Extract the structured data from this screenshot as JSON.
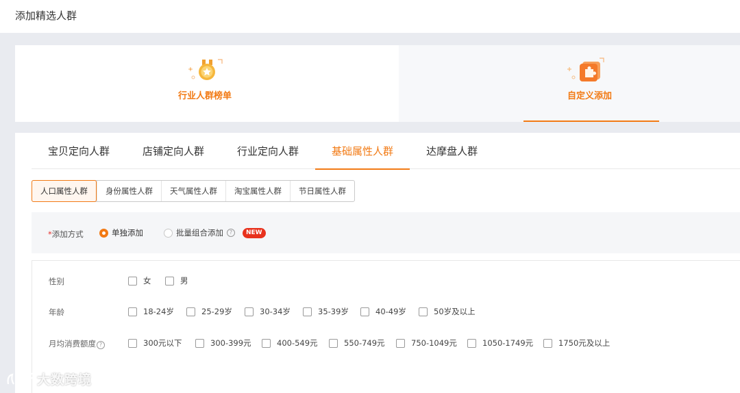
{
  "page": {
    "title": "添加精选人群"
  },
  "cards": [
    {
      "label": "行业人群榜单",
      "icon": "medal-icon"
    },
    {
      "label": "自定义添加",
      "icon": "puzzle-icon"
    }
  ],
  "tabs": [
    {
      "label": "宝贝定向人群"
    },
    {
      "label": "店铺定向人群"
    },
    {
      "label": "行业定向人群"
    },
    {
      "label": "基础属性人群"
    },
    {
      "label": "达摩盘人群"
    }
  ],
  "subtabs": [
    {
      "label": "人口属性人群"
    },
    {
      "label": "身份属性人群"
    },
    {
      "label": "天气属性人群"
    },
    {
      "label": "淘宝属性人群"
    },
    {
      "label": "节日属性人群"
    }
  ],
  "method": {
    "required_mark": "*",
    "label": "添加方式",
    "options": [
      {
        "label": "单独添加",
        "selected": true
      },
      {
        "label": "批量组合添加",
        "selected": false
      }
    ],
    "help_icon": "question-circle-icon",
    "badge": "NEW"
  },
  "attributes": [
    {
      "label": "性别",
      "options": [
        "女",
        "男"
      ]
    },
    {
      "label": "年龄",
      "options": [
        "18-24岁",
        "25-29岁",
        "30-34岁",
        "35-39岁",
        "40-49岁",
        "50岁及以上"
      ]
    },
    {
      "label": "月均消费额度",
      "options": [
        "300元以下",
        "300-399元",
        "400-549元",
        "550-749元",
        "750-1049元",
        "1050-1749元",
        "1750元及以上"
      ]
    }
  ],
  "watermark": {
    "text": "大数跨境"
  },
  "colors": {
    "accent": "#f27a14",
    "badge": "#e8321d",
    "page_bg": "#e9ebf0"
  }
}
